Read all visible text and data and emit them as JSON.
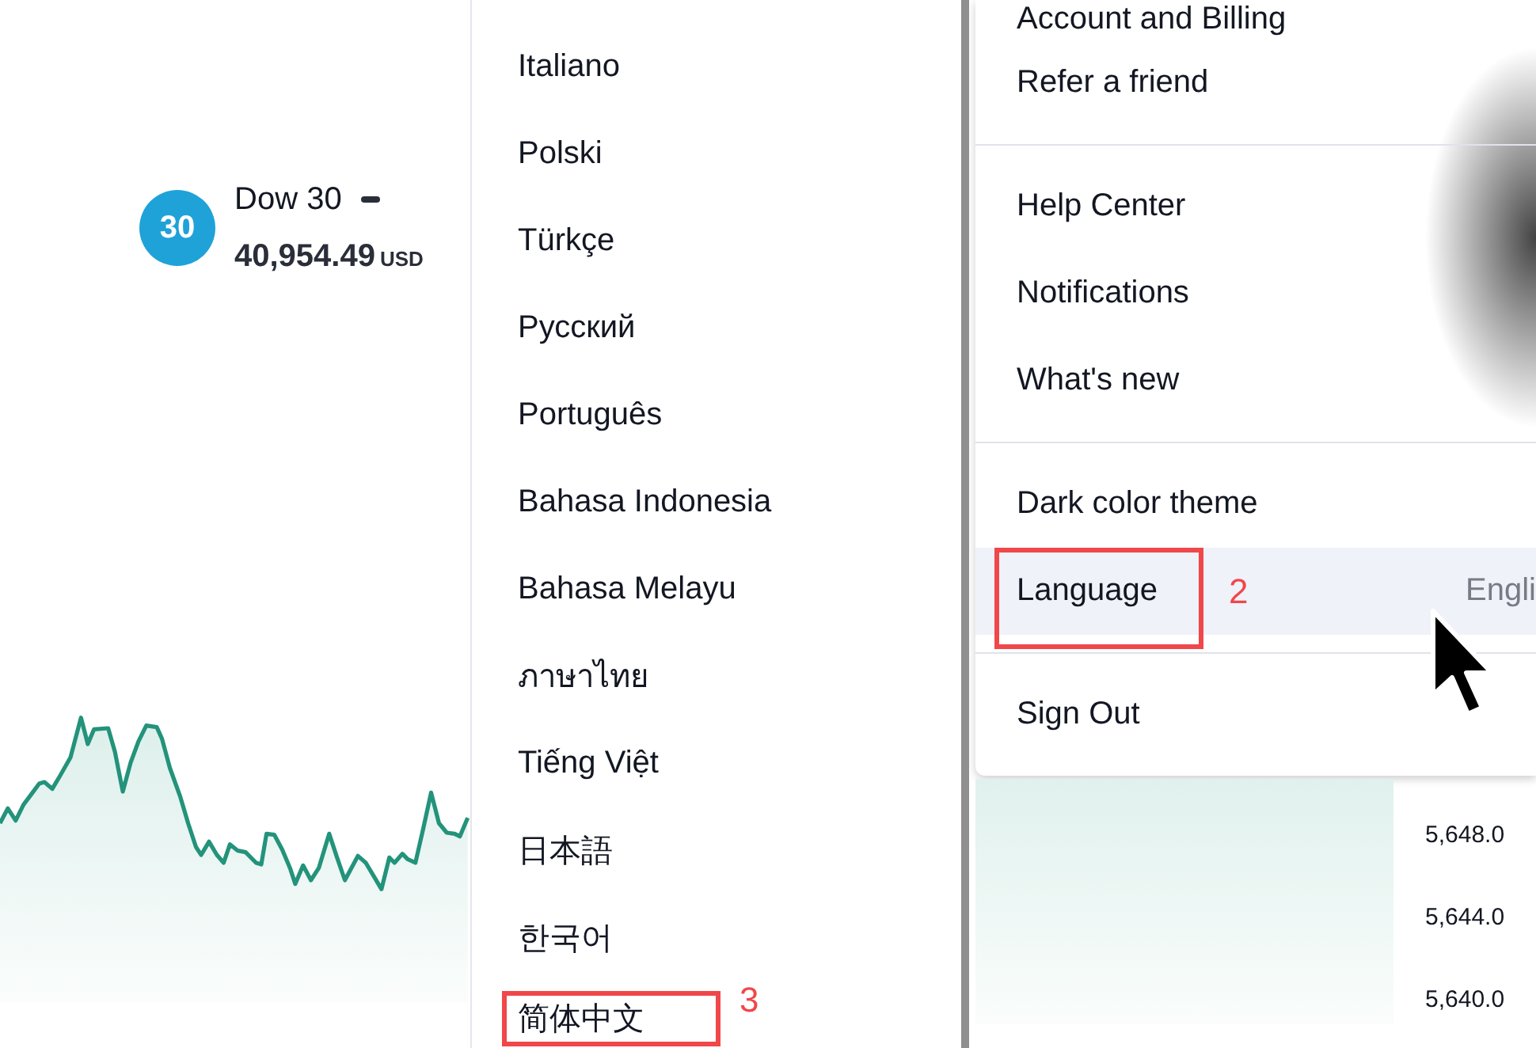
{
  "instrument": {
    "badge": "30",
    "name": "Dow 30",
    "price": "40,954.49",
    "currency": "USD"
  },
  "language_menu": {
    "items": [
      {
        "label": "Italiano"
      },
      {
        "label": "Polski"
      },
      {
        "label": "Türkçe"
      },
      {
        "label": "Русский"
      },
      {
        "label": "Português"
      },
      {
        "label": "Bahasa Indonesia"
      },
      {
        "label": "Bahasa Melayu"
      },
      {
        "label": "ภาษาไทย"
      },
      {
        "label": "Tiếng Việt"
      },
      {
        "label": "日本語"
      },
      {
        "label": "한국어"
      },
      {
        "label": "简体中文",
        "annotation": "3"
      }
    ]
  },
  "account_menu": {
    "sections": [
      {
        "items": [
          {
            "label": "Account and Billing",
            "highlighted": false
          },
          {
            "label": "Refer a friend",
            "highlighted": false
          }
        ]
      },
      {
        "items": [
          {
            "label": "Help Center",
            "highlighted": false
          },
          {
            "label": "Notifications",
            "highlighted": false
          },
          {
            "label": "What's new",
            "highlighted": false
          }
        ]
      },
      {
        "items": [
          {
            "label": "Dark color theme",
            "highlighted": false
          },
          {
            "label": "Language",
            "value": "Engli",
            "highlighted": true,
            "annotation": "2"
          }
        ]
      },
      {
        "items": [
          {
            "label": "Sign Out",
            "highlighted": false
          }
        ]
      }
    ]
  },
  "price_axis": {
    "labels": [
      "5,648.0",
      "5,644.0",
      "5,640.0"
    ]
  }
}
